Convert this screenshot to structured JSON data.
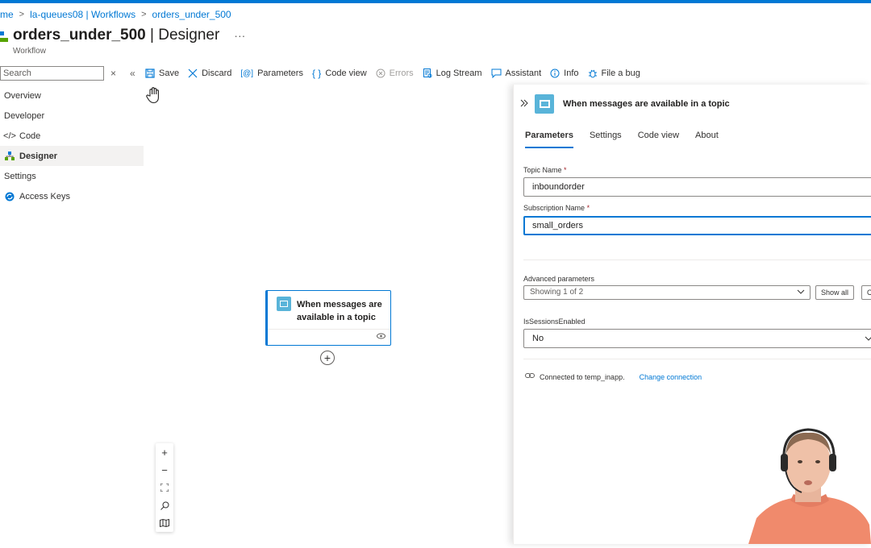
{
  "breadcrumb": {
    "items": [
      "me",
      "la-queues08 | Workflows",
      "orders_under_500"
    ]
  },
  "header": {
    "title_bold": "orders_under_500",
    "title_rest": " | Designer",
    "more": "···",
    "subtitle": "Workflow"
  },
  "sidebar": {
    "search_placeholder": "Search",
    "close_icon": "×",
    "collapse_icon": "«",
    "items": [
      {
        "label": "Overview",
        "icon": ""
      },
      {
        "label": "Developer",
        "icon": ""
      },
      {
        "label": "Code",
        "icon": "</>"
      },
      {
        "label": "Designer",
        "icon": "designer-icon"
      },
      {
        "label": "Settings",
        "icon": ""
      },
      {
        "label": "Access Keys",
        "icon": "key-icon"
      }
    ]
  },
  "toolbar": {
    "save": "Save",
    "discard": "Discard",
    "parameters": "Parameters",
    "code_view": "Code view",
    "errors": "Errors",
    "log_stream": "Log Stream",
    "assistant": "Assistant",
    "info": "Info",
    "file_bug": "File a bug"
  },
  "canvas": {
    "node_title": "When messages are available in a topic",
    "zoom_in": "+",
    "zoom_out": "−"
  },
  "panel": {
    "title": "When messages are available in a topic",
    "tabs": [
      "Parameters",
      "Settings",
      "Code view",
      "About"
    ],
    "topic_label": "Topic Name",
    "topic_value": "inboundorder",
    "subscription_label": "Subscription Name",
    "subscription_value": "small_orders",
    "required_mark": "*",
    "advanced_label": "Advanced parameters",
    "advanced_value": "Showing 1 of 2",
    "show_all": "Show all",
    "clear": "C",
    "sessions_label": "IsSessionsEnabled",
    "sessions_value": "No",
    "connected_text": "Connected to temp_inapp.",
    "change_connection": "Change connection"
  },
  "colors": {
    "accent": "#0078d4",
    "servicebus": "#59b4d9"
  }
}
